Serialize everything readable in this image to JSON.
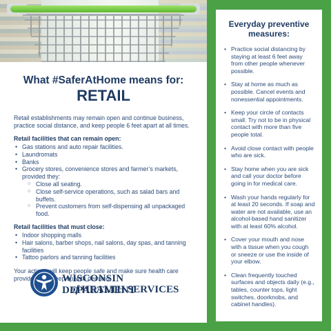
{
  "header": {
    "heading_line1": "What #SaferAtHome means for:",
    "heading_line2": "RETAIL"
  },
  "intro": "Retail establishments may remain open and continue business, practice social distance, and keep people 6 feet apart at all times.",
  "open_section": {
    "title": "Retail facilities that can remain open:",
    "items": [
      "Gas stations and auto repair facilities.",
      "Laundromats",
      "Banks",
      "Grocery stores, convenience stores and farmer’s markets, provided they:"
    ],
    "sub_items": [
      "Close all seating.",
      "Close self-service operations, such as salad bars and buffets.",
      "Prevent customers from self-dispensing all unpackaged food."
    ]
  },
  "close_section": {
    "title": "Retail facilities that must close:",
    "items": [
      "Indoor shopping malls",
      "Hair salons, barber shops, nail salons, day spas, and tanning facilities",
      "Tattoo parlors and tanning facilities"
    ]
  },
  "closing": "Your actions will keep people safe and make sure health care providers can keep up with demand.",
  "logo": {
    "line1": "WISCONSIN DEPARTMENT",
    "line2_of": "of",
    "line2": "HEALTH SERVICES"
  },
  "sidebar": {
    "title": "Everyday preventive measures:",
    "items": [
      "Practice social distancing by staying at least 6 feet away from other people whenever possible.",
      "Stay at home as much as possible. Cancel events and nonessential appointments.",
      "Keep your circle of contacts small. Try not to be in physical contact with more than five people total.",
      "Avoid close contact with people who are sick.",
      "Stay home when you are sick and call your doctor before going in for medical care.",
      "Wash your hands regularly for at least 20 seconds. If soap and water are not available, use an alcohol-based hand sanitizer with at least 60% alcohol.",
      "Cover your mouth and nose with a tissue when you cough or sneeze or use the inside of your elbow.",
      "Clean frequently touched surfaces and objects daily (e.g., tables, counter tops, light switches, doorknobs, and cabinet handles)."
    ]
  },
  "colors": {
    "accent_green": "#4aa146",
    "navy": "#1f3b63"
  }
}
